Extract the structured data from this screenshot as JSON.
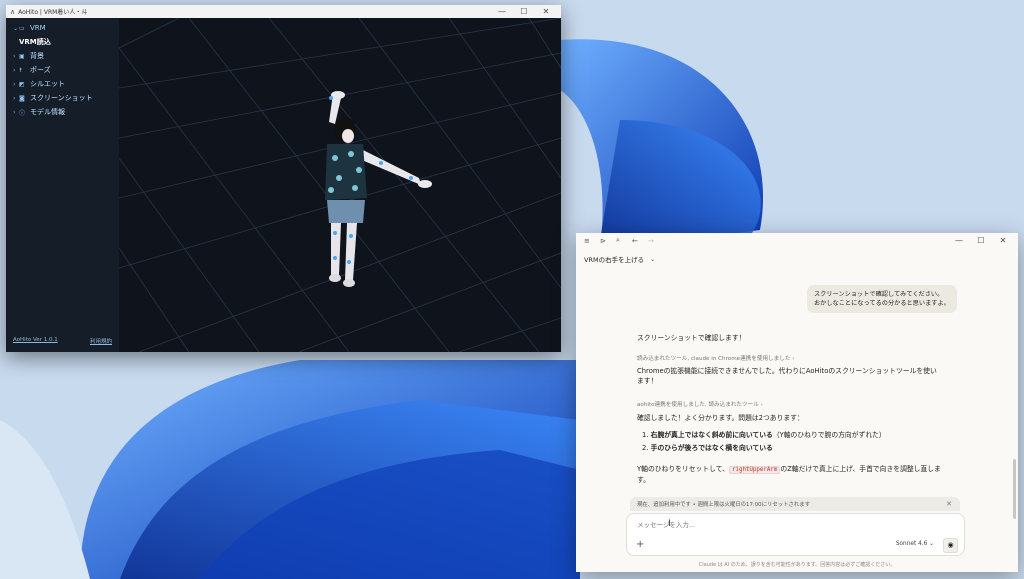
{
  "aohito": {
    "title": "AoHito | VRM着い人・斗",
    "sidebar": {
      "items": [
        {
          "label": "VRM",
          "icon": "folder-icon",
          "expanded": true
        },
        {
          "label": "VRM読込",
          "sub": true
        },
        {
          "label": "背景",
          "icon": "image-icon"
        },
        {
          "label": "ポーズ",
          "icon": "pose-icon"
        },
        {
          "label": "シルエット",
          "icon": "silhouette-icon"
        },
        {
          "label": "スクリーンショット",
          "icon": "camera-icon"
        },
        {
          "label": "モデル情報",
          "icon": "info-icon"
        }
      ],
      "version": "AoHito Ver 1.0.1",
      "terms": "利用規約"
    }
  },
  "claude": {
    "conversation_title": "VRMの右手を上げる",
    "user_message": {
      "line1": "スクリーンショットで確認してみてください。",
      "line2": "おかしなことになってるの分かると思いますよ。"
    },
    "assistant": {
      "intro": "スクリーンショットで確認します！",
      "tool1": "読み込まれたツール, claude in Chrome連携を使用しました  ›",
      "msg1": "Chromeの拡張機能に接続できませんでした。代わりにAoHitoのスクリーンショットツールを使います！",
      "tool2": "aohito連携を使用しました, 読み込まれたツール  ›",
      "msg2": "確認しました！よく分かります。問題は2つあります：",
      "list": [
        {
          "n": "1.",
          "bold": "右腕が真上ではなく斜め前に向いている",
          "rest": "（Y軸のひねりで腕の方向がずれた）"
        },
        {
          "n": "2.",
          "bold": "手のひらが後ろではなく横を向いている",
          "rest": ""
        }
      ],
      "msg3_pre": "Y軸のひねりをリセットして、",
      "msg3_code": "rightUpperArm",
      "msg3_post": "のZ軸だけで真上に上げ、手首で向きを調整し直します。"
    },
    "notice": "現在、追加利用中です • 週間上限は火曜日の17:00にリセットされます",
    "composer": {
      "placeholder": "メッセージを入力...",
      "model": "Sonnet 4.6"
    },
    "disclaimer": "Claude は AI のため、誤りを含む可能性があります。回答内容は必ずご確認ください。"
  },
  "colors": {
    "accent": "#2a6de0",
    "aohito_bg": "#141a24",
    "claude_bg": "#faf9f6"
  }
}
